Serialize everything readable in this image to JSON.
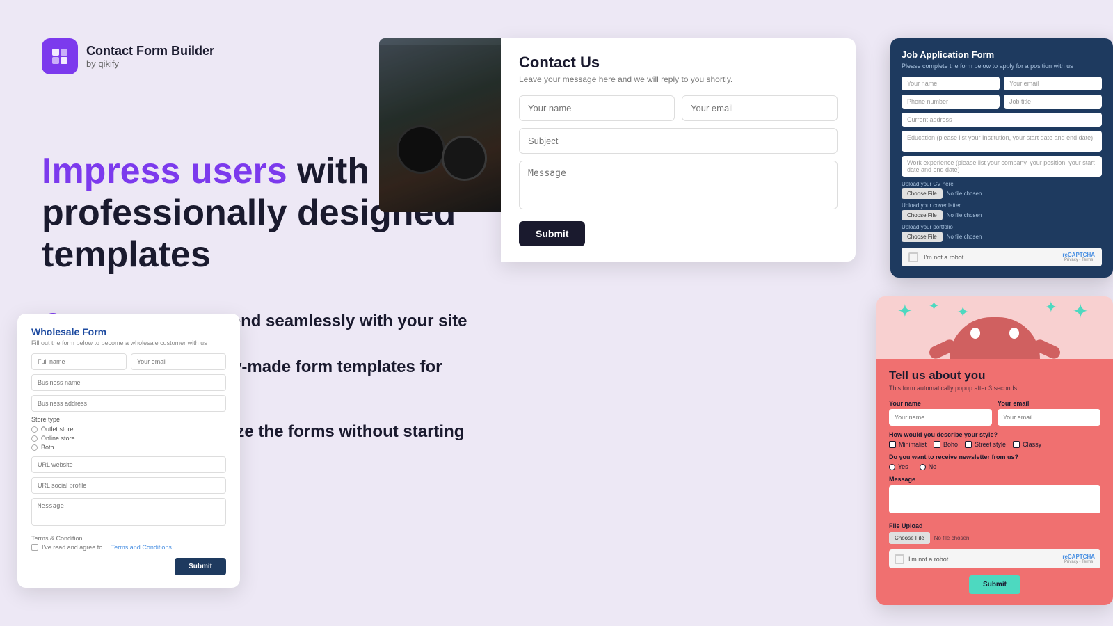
{
  "app": {
    "logo_icon": "◈",
    "title": "Contact Form Builder",
    "subtitle": "by qikify"
  },
  "hero": {
    "headline_highlight": "Impress users",
    "headline_rest": " with professionally designed templates"
  },
  "features": [
    {
      "id": "feature-1",
      "text": "Select forms that blend seamlessly with your site"
    },
    {
      "id": "feature-2",
      "text": "Save time with ready-made form templates for different use cases"
    },
    {
      "id": "feature-3",
      "text": "Effortlessly customize the forms without starting from scratch"
    }
  ],
  "contact_form": {
    "title": "Contact Us",
    "subtitle": "Leave your message here and we will reply to you shortly.",
    "name_placeholder": "Your name",
    "email_placeholder": "Your email",
    "subject_placeholder": "Subject",
    "message_placeholder": "Message",
    "submit_label": "Submit"
  },
  "job_form": {
    "title": "Job Application Form",
    "subtitle": "Please complete the form below to apply for a position with us",
    "name_placeholder": "Your name",
    "email_placeholder": "Your email",
    "phone_placeholder": "Phone number",
    "job_placeholder": "Job title",
    "address_placeholder": "Current address",
    "education_label": "Education (please list your Institution, your start date and end date)",
    "work_label": "Work experience (please list your company, your position, your start date and end date)",
    "cv_label": "Upload your CV here",
    "cover_label": "Upload your cover letter",
    "portfolio_label": "Upload your portfolio",
    "choose_file": "Choose File",
    "no_file": "No file chosen",
    "captcha_label": "I'm not a robot"
  },
  "wholesale_form": {
    "title": "Wholesale Form",
    "subtitle": "Fill out the form below to become a wholesale customer with us",
    "fullname_placeholder": "Full name",
    "email_placeholder": "Your email",
    "business_placeholder": "Business name",
    "address_placeholder": "Business address",
    "store_type_label": "Store type",
    "store_options": [
      "Outlet store",
      "Online store",
      "Both"
    ],
    "url_placeholder": "URL website",
    "social_placeholder": "URL social profile",
    "message_placeholder": "Message",
    "terms_label": "Terms & Condition",
    "terms_check": "I've read and agree to",
    "terms_link": "Terms and Conditions",
    "submit_label": "Submit"
  },
  "tellus_form": {
    "title": "Tell us about you",
    "subtitle": "This form automatically popup after 3 seconds.",
    "name_label": "Your name",
    "email_label": "Your email",
    "name_placeholder": "Your name",
    "email_placeholder": "Your email",
    "style_label": "How would you describe your style?",
    "style_options": [
      "Minimalist",
      "Boho",
      "Street style",
      "Classy"
    ],
    "newsletter_label": "Do you want to receive newsletter from us?",
    "newsletter_options": [
      "Yes",
      "No"
    ],
    "message_label": "Message",
    "file_label": "File Upload",
    "choose_file": "Choose File",
    "no_file": "No file chosen",
    "captcha_label": "I'm not a robot",
    "submit_label": "Submit"
  }
}
